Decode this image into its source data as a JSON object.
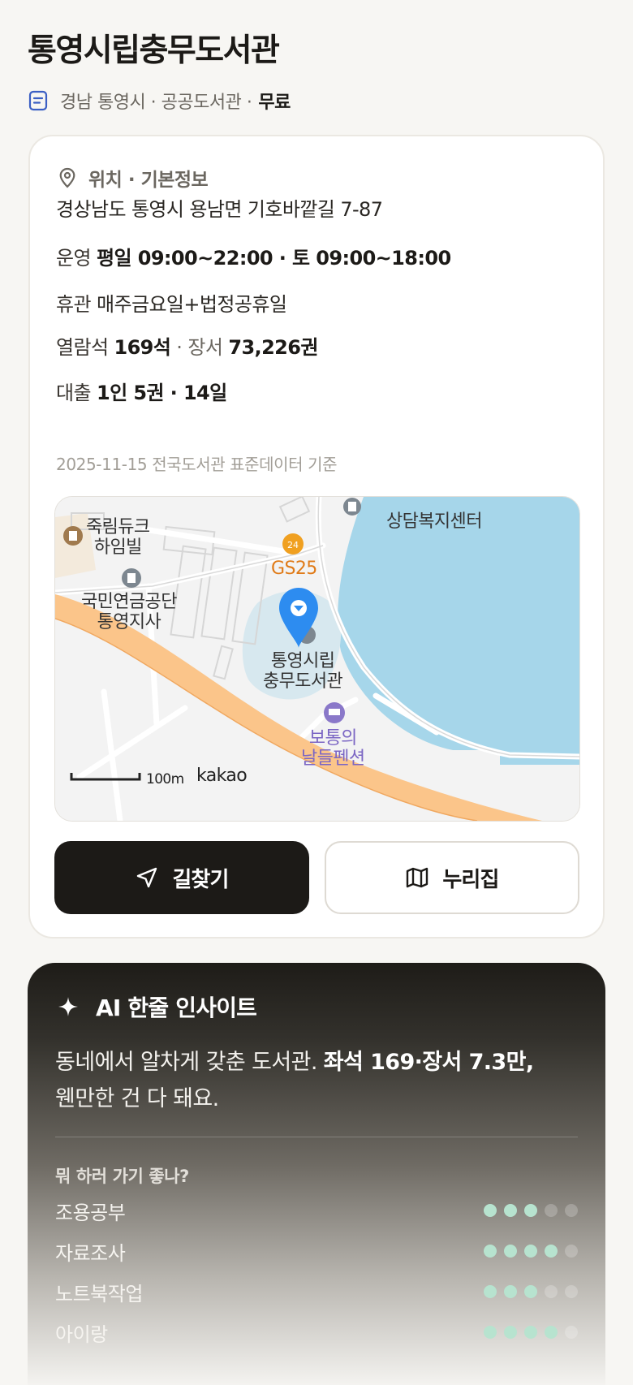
{
  "header": {
    "title": "통영시립충무도서관",
    "meta": "경남 통영시 · 공공도서관 ·",
    "price": "무료"
  },
  "info": {
    "section_title": "위치 · 기본정보",
    "address": "경상남도 통영시 용남면 기호바깥길 7-87",
    "hours_label": "운영",
    "hours_value": "평일 09:00~22:00 · 토 09:00~18:00",
    "closed_label": "휴관",
    "closed_value": "매주금요일+법정공휴일",
    "seats_label": "열람석",
    "seats_value": "169석",
    "books_sep": "· 장서",
    "books_value": "73,226권",
    "loan_label": "대출",
    "loan_value": "1인 5권 · 14일",
    "source": "2025-11-15 전국도서관 표준데이터 기준"
  },
  "map": {
    "labels": {
      "counsel": "상담복지센터",
      "apartment": "죽림듀크\n하임빌",
      "gs25": "GS25",
      "pension_office": "국민연금공단\n통영지사",
      "library": "통영시립\n충무도서관",
      "pension_house": "보통의\n날들펜션"
    },
    "scale": "100m",
    "brand": "kakao",
    "colors": {
      "sea": "#a6d6ea",
      "road": "#fbc58a",
      "marker": "#2d8cf0"
    }
  },
  "buttons": {
    "directions": "길찾기",
    "nurijip": "누리집"
  },
  "ai": {
    "title": "AI 한줄 인사이트",
    "text_plain": "동네에서 알차게 갖춘 도서관.",
    "text_bold": "좌석 169·장서 7.3만,",
    "text_end": "웬만한 건 다 돼요.",
    "question": "뭐 하러 가기 좋나?",
    "activities": [
      {
        "name": "조용공부",
        "score": 3,
        "max": 5
      },
      {
        "name": "자료조사",
        "score": 4,
        "max": 5
      },
      {
        "name": "노트북작업",
        "score": 3,
        "max": 5
      },
      {
        "name": "아이랑",
        "score": 4,
        "max": 5
      }
    ],
    "dot_color": "#b7e3cf"
  }
}
